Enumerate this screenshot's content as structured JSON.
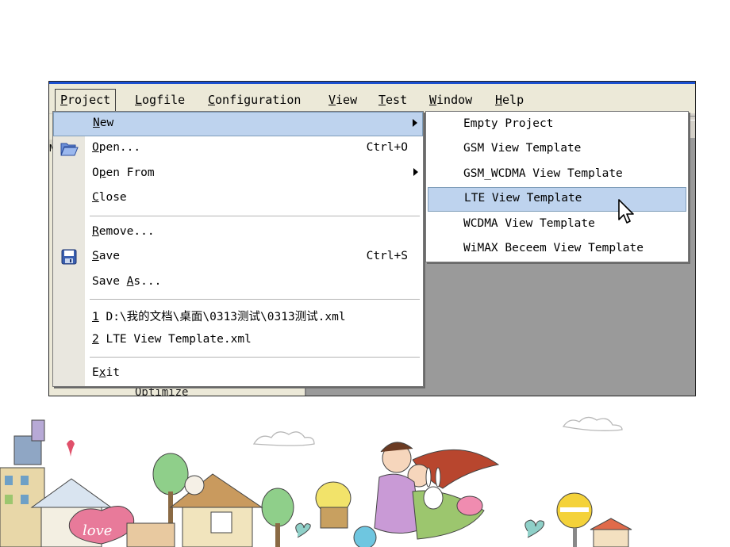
{
  "menubar": {
    "items": [
      {
        "label": "Project"
      },
      {
        "label": "Logfile"
      },
      {
        "label": "Configuration"
      },
      {
        "label": "View"
      },
      {
        "label": "Test"
      },
      {
        "label": "Window"
      },
      {
        "label": "Help"
      }
    ]
  },
  "project_menu": {
    "items": [
      {
        "label": "New",
        "submenu": true,
        "highlighted": true
      },
      {
        "label": "Open...",
        "shortcut": "Ctrl+O",
        "icon": "folder-open-icon"
      },
      {
        "label": "Open From",
        "submenu": true
      },
      {
        "label": "Close"
      },
      {
        "label": "Remove..."
      },
      {
        "label": "Save",
        "shortcut": "Ctrl+S",
        "icon": "floppy-disk-icon"
      },
      {
        "label": "Save As..."
      },
      {
        "label": "1 D:\\我的文档\\桌面\\0313测试\\0313测试.xml"
      },
      {
        "label": "2 LTE View Template.xml"
      },
      {
        "label": "Exit"
      }
    ]
  },
  "new_submenu": {
    "items": [
      {
        "label": "Empty Project"
      },
      {
        "label": "GSM View Template"
      },
      {
        "label": "GSM_WCDMA View Template"
      },
      {
        "label": "LTE View Template",
        "highlighted": true
      },
      {
        "label": "WCDMA View Template"
      },
      {
        "label": "WiMAX Beceem View Template"
      }
    ]
  },
  "background": {
    "tree_item": "Optimize",
    "left_edge_glyph": "N"
  },
  "illustration": {
    "sign_text": "love"
  },
  "colors": {
    "highlight": "#bed3ee",
    "highlight_border": "#7f9db9",
    "menubar_bg": "#ece9d8",
    "workspace_bg": "#9a9a9a",
    "title_blue": "#1a4fd0"
  }
}
